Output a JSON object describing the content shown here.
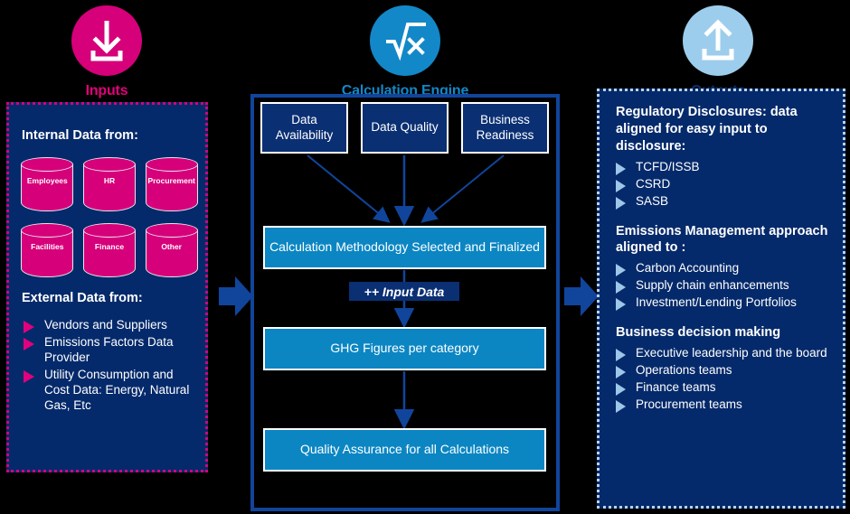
{
  "colors": {
    "pink": "#d6007a",
    "navy": "#052a6b",
    "engine_blue": "#10459b",
    "light_blue": "#0b86c3",
    "pale_blue": "#9dc6e8",
    "background": "#000000"
  },
  "columns": {
    "inputs": {
      "label": "Inputs",
      "icon": "download-arrow-icon",
      "label_color": "#e3007c",
      "icon_bg": "#d6007a"
    },
    "engine": {
      "label": "Calculation Engine",
      "icon": "square-root-icon",
      "label_color": "#1288c8",
      "icon_bg": "#1288c8"
    },
    "outputs": {
      "label": "Outputs",
      "icon": "upload-arrow-icon",
      "label_color": "#0a2f73",
      "icon_bg": "#9dcdec"
    }
  },
  "inputs_panel": {
    "internal_heading": "Internal Data from:",
    "sources": [
      {
        "label": "Employees"
      },
      {
        "label": "HR"
      },
      {
        "label": "Procurement"
      },
      {
        "label": "Facilities"
      },
      {
        "label": "Finance"
      },
      {
        "label": "Other"
      }
    ],
    "external_heading": "External Data from:",
    "external_items": [
      "Vendors and Suppliers",
      "Emissions Factors Data Provider",
      "Utility Consumption and Cost Data: Energy, Natural Gas, Etc"
    ]
  },
  "engine_panel": {
    "criteria_boxes": [
      "Data Availability",
      "Data Quality",
      "Business Readiness"
    ],
    "flow": [
      "Calculation Methodology Selected and Finalized",
      "GHG Figures per category",
      "Quality Assurance for all Calculations"
    ],
    "input_data_tag": "++ Input Data"
  },
  "outputs_panel": {
    "sections": [
      {
        "heading": "Regulatory Disclosures: data aligned for easy input to disclosure:",
        "items": [
          "TCFD/ISSB",
          "CSRD",
          "SASB"
        ]
      },
      {
        "heading": "Emissions  Management approach aligned to :",
        "items": [
          "Carbon Accounting",
          "Supply chain enhancements",
          "Investment/Lending Portfolios"
        ]
      },
      {
        "heading": "Business decision making",
        "items": [
          "Executive leadership and the board",
          "Operations teams",
          "Finance teams",
          "Procurement teams"
        ]
      }
    ]
  }
}
